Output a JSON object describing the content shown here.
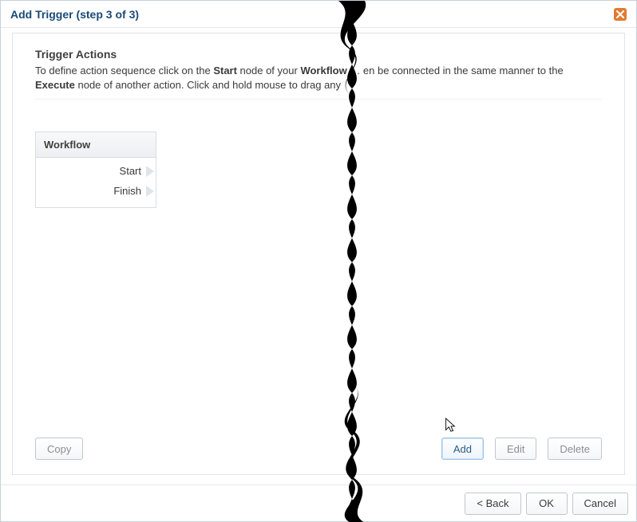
{
  "dialog": {
    "title": "Add Trigger (step 3 of 3)"
  },
  "section": {
    "heading": "Trigger Actions",
    "intro_p1": "To define action sequence click on the ",
    "intro_b1": "Start",
    "intro_p2": " node of your ",
    "intro_b2": "Workflow",
    "intro_p3": " … en be connected in the same manner to the ",
    "intro_b3": "Execute",
    "intro_p4": " node of another action. Click and hold mouse to drag any"
  },
  "workflow": {
    "header": "Workflow",
    "nodes": [
      {
        "label": "Start"
      },
      {
        "label": "Finish"
      }
    ]
  },
  "card_buttons": {
    "copy": "Copy",
    "add": "Add",
    "edit": "Edit",
    "delete": "Delete"
  },
  "footer": {
    "back": "< Back",
    "ok": "OK",
    "cancel": "Cancel"
  }
}
